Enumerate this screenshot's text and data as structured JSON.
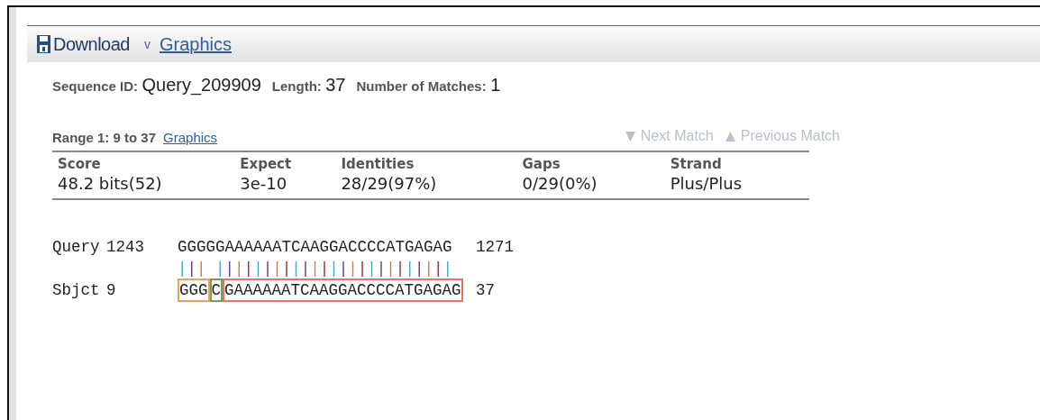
{
  "toolbar": {
    "download": "Download",
    "caret": "v",
    "graphics": "Graphics"
  },
  "summary": [
    {
      "label": "Sequence ID:",
      "value": "Query_209909"
    },
    {
      "label": "Length:",
      "value": "37"
    },
    {
      "label": "Number of Matches:",
      "value": "1"
    }
  ],
  "range": {
    "label": "Range 1: 9 to 37",
    "link": "Graphics",
    "next": {
      "label": "Next Match",
      "disabled": true
    },
    "previous": {
      "label": "Previous Match",
      "disabled": true
    }
  },
  "stats": {
    "columns": [
      "Score",
      "Expect",
      "Identities",
      "Gaps",
      "Strand"
    ],
    "values": [
      "48.2 bits(52)",
      "3e-10",
      "28/29(97%)",
      "0/29(0%)",
      "Plus/Plus"
    ]
  },
  "alignment": {
    "query": {
      "label": "Query",
      "start": "1243",
      "sequence": "GGGGGAAAAAATCAAGGACCCCATGAGAG",
      "end": "1271"
    },
    "match": "||| |||||||||||||||||||||||||",
    "subject": {
      "label": "Sbjct",
      "start": "9",
      "segments": [
        {
          "text": "GGG",
          "color": "#f0a050"
        },
        {
          "text": "C",
          "color": "#6aa060"
        },
        {
          "text": "GAAAAAATCAAGGACCCCATGAGAG",
          "color": "#f07060"
        }
      ],
      "end": "37"
    }
  }
}
